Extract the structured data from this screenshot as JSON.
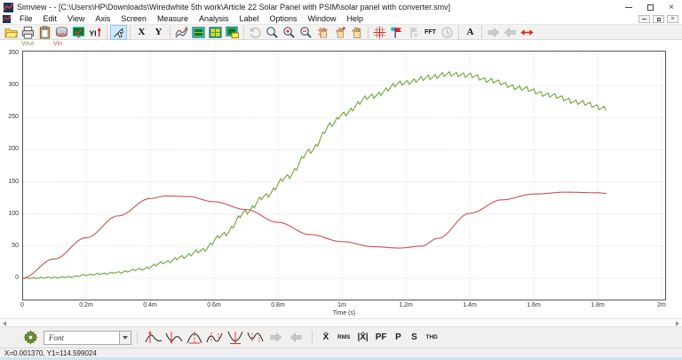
{
  "window": {
    "title": "Simview -  - [C:\\Users\\HP\\Downloads\\Wiredwhite 5th work\\Article 22 Solar Panel with PSIM\\solar panel with converter.smv]",
    "close_glyph": "×"
  },
  "menu": {
    "items": [
      "File",
      "Edit",
      "View",
      "Axis",
      "Screen",
      "Measure",
      "Analysis",
      "Label",
      "Options",
      "Window",
      "Help"
    ]
  },
  "toolbar": {
    "labels": {
      "data": "DATA",
      "yi": "YI",
      "x": "X",
      "y": "Y",
      "fft": "FFT",
      "a": "A"
    }
  },
  "legend": [
    {
      "label": "Vout",
      "color": "#6fa33c"
    },
    {
      "label": "Vin",
      "color": "#c85250"
    }
  ],
  "chart_data": {
    "type": "line",
    "xlabel": "Time (s)",
    "grid": true,
    "legend_position": "top-left",
    "xlim_ms": [
      0,
      2
    ],
    "ylim": [
      -35,
      352
    ],
    "x_ticks_ms": [
      0,
      0.2,
      0.4,
      0.6,
      0.8,
      1.0,
      1.2,
      1.4,
      1.6,
      1.8,
      2.0
    ],
    "x_tick_labels": [
      "0",
      "0.2m",
      "0.4m",
      "0.6m",
      "0.8m",
      "1m",
      "1.2m",
      "1.4m",
      "1.6m",
      "1.8m",
      "2m"
    ],
    "y_ticks": [
      0,
      50,
      100,
      150,
      200,
      250,
      300,
      350
    ],
    "series": [
      {
        "name": "Vout",
        "color": "#6fa33c",
        "style": "staircase-ripple",
        "ripple": {
          "period_ms": 0.022,
          "rise_fraction": 0.78,
          "amplitude_profile": [
            [
              0,
              1.5
            ],
            [
              0.3,
              2.5
            ],
            [
              0.5,
              5
            ],
            [
              0.7,
              7
            ],
            [
              1.83,
              7
            ]
          ]
        },
        "points_ms": [
          [
            0,
            0
          ],
          [
            0.1,
            1
          ],
          [
            0.15,
            2
          ],
          [
            0.2,
            5
          ],
          [
            0.25,
            7
          ],
          [
            0.3,
            9
          ],
          [
            0.37,
            14
          ],
          [
            0.45,
            25
          ],
          [
            0.5,
            33
          ],
          [
            0.56,
            43
          ],
          [
            0.63,
            68
          ],
          [
            0.7,
            103
          ],
          [
            0.76,
            128
          ],
          [
            0.83,
            158
          ],
          [
            0.9,
            198
          ],
          [
            0.97,
            240
          ],
          [
            1.0,
            255
          ],
          [
            1.09,
            283
          ],
          [
            1.19,
            304
          ],
          [
            1.28,
            313
          ],
          [
            1.33,
            318
          ],
          [
            1.4,
            316
          ],
          [
            1.46,
            308
          ],
          [
            1.56,
            296
          ],
          [
            1.65,
            285
          ],
          [
            1.74,
            274
          ],
          [
            1.83,
            264
          ]
        ]
      },
      {
        "name": "Vin",
        "color": "#c85250",
        "style": "smooth",
        "points_ms": [
          [
            0,
            0
          ],
          [
            0.1,
            30
          ],
          [
            0.2,
            63
          ],
          [
            0.3,
            97
          ],
          [
            0.4,
            124
          ],
          [
            0.45,
            128
          ],
          [
            0.52,
            127
          ],
          [
            0.6,
            119
          ],
          [
            0.7,
            107
          ],
          [
            0.8,
            87
          ],
          [
            0.9,
            68
          ],
          [
            1.0,
            57
          ],
          [
            1.1,
            49
          ],
          [
            1.18,
            47
          ],
          [
            1.25,
            50
          ],
          [
            1.3,
            62
          ],
          [
            1.4,
            101
          ],
          [
            1.5,
            122
          ],
          [
            1.6,
            131
          ],
          [
            1.7,
            134
          ],
          [
            1.8,
            133
          ],
          [
            1.83,
            132
          ]
        ]
      }
    ]
  },
  "bottom_toolbar": {
    "font_label": "Font",
    "stats": [
      "X̄",
      "RMS",
      "|X̄|",
      "PF",
      "P",
      "S",
      "THD"
    ]
  },
  "status_bar": {
    "text": "X=0.001370, Y1=114.599024"
  }
}
